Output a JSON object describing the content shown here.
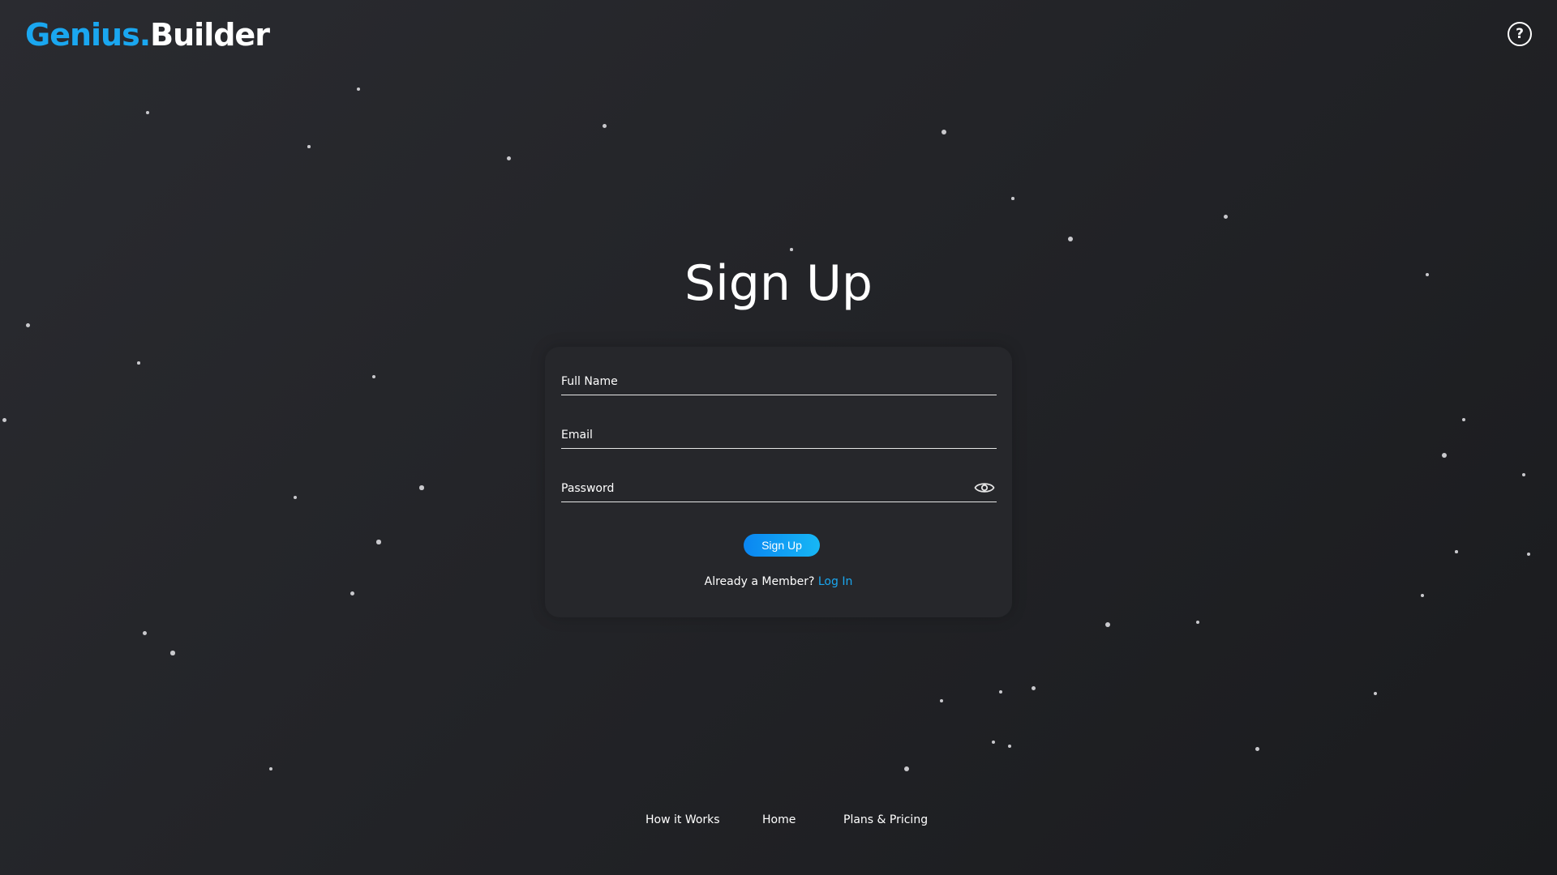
{
  "header": {
    "logo_accent": "Genius.",
    "logo_rest": "Builder",
    "help_icon": "help-circle-icon",
    "help_glyph": "?"
  },
  "page": {
    "title": "Sign Up"
  },
  "form": {
    "full_name_placeholder": "Full Name",
    "full_name_value": "",
    "email_placeholder": "Email",
    "email_value": "",
    "password_placeholder": "Password",
    "password_value": "",
    "password_toggle_icon": "eye-icon",
    "submit_label": "Sign Up",
    "member_prompt": "Already a Member?",
    "login_label": "Log In"
  },
  "footer": {
    "links": [
      {
        "label": "How it Works"
      },
      {
        "label": "Home"
      },
      {
        "label": "Plans & Pricing"
      }
    ]
  },
  "colors": {
    "brand_accent": "#1aa7f0",
    "button_gradient_start": "#0a86f2",
    "button_gradient_end": "#17b7f5",
    "background": "#232428",
    "card_background": "#26272b"
  }
}
